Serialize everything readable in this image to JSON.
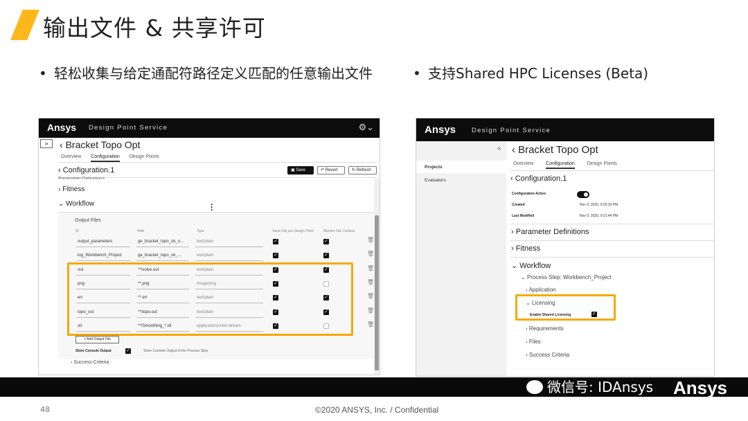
{
  "slide": {
    "title": "输出文件 & 共享许可",
    "bullets": [
      "轻松收集与给定通配符路径定义匹配的任意输出文件",
      "支持Shared HPC Licenses (Beta)"
    ],
    "bullet_marker": "•",
    "page_number": "48",
    "copyright": "©2020 ANSYS, Inc. / Confidential",
    "watermark": "微信号: IDAnsys",
    "footer_logo": "Ansys",
    "accent_color": "#ffb71b"
  },
  "app": {
    "logo": "Ansys",
    "name": "Design Point Service",
    "gear_icon": "⚙⌄",
    "expand_icon": "»",
    "collapse_icon": "«",
    "back_icon": "‹",
    "project_title": "Bracket Topo Opt",
    "tabs": [
      "Overview",
      "Configuration",
      "Design Points"
    ],
    "config_title": "Configuration.1"
  },
  "panel1": {
    "toolbar": {
      "save": "Save",
      "revert": "Revert",
      "refresh": "Refresh"
    },
    "partial_section": "Parameter Definitions",
    "fitness": "Fitness",
    "workflow": "Workflow",
    "output_files_label": "Output Files",
    "columns": [
      "ID",
      "Path",
      "Type",
      "Store File per Design Point",
      "Monitor File Content"
    ],
    "rows": [
      {
        "id": "output_parameters",
        "path": "ge_bracket_topo_ok_o...",
        "type": "text/plain",
        "store": true,
        "monitor": true
      },
      {
        "id": "log_Workbench_Project",
        "path": "ge_bracket_topo_ok_...",
        "type": "text/plain",
        "store": true,
        "monitor": true
      },
      {
        "id": "out",
        "path": "**/solve.out",
        "type": "text/plain",
        "store": true,
        "monitor": true
      },
      {
        "id": "png",
        "path": "**.png",
        "type": "image/png",
        "store": true,
        "monitor": false
      },
      {
        "id": "err",
        "path": "**.err",
        "type": "text/plain",
        "store": true,
        "monitor": true
      },
      {
        "id": "topo_out",
        "path": "**/topo.out",
        "type": "text/plain",
        "store": true,
        "monitor": true
      },
      {
        "id": "stl",
        "path": "**/Smoothing_*.stl",
        "type": "application/octet-stream",
        "store": true,
        "monitor": false
      }
    ],
    "add_output_file": "+ Add Output File",
    "store_console_label": "Store Console Output",
    "store_console_desc": "Store Console Output of the Process Step",
    "success_criteria": "Success Criteria"
  },
  "panel2": {
    "sidebar": [
      "Projects",
      "Evaluators"
    ],
    "config_active_label": "Configuration Active",
    "created_label": "Created",
    "created_value": "Nov 9, 2020, 9:20:30 PM",
    "modified_label": "Last Modified",
    "modified_value": "Nov 9, 2020, 9:21:44 PM",
    "parameter_definitions": "Parameter Definitions",
    "fitness": "Fitness",
    "workflow": "Workflow",
    "process_step_label": "Process Step:",
    "process_step_value": "Workbench_Project",
    "application": "Application",
    "licensing": "Licensing",
    "enable_shared_licensing": "Enable Shared Licensing",
    "requirements": "Requirements",
    "files": "Files",
    "success_criteria": "Success Criteria"
  }
}
